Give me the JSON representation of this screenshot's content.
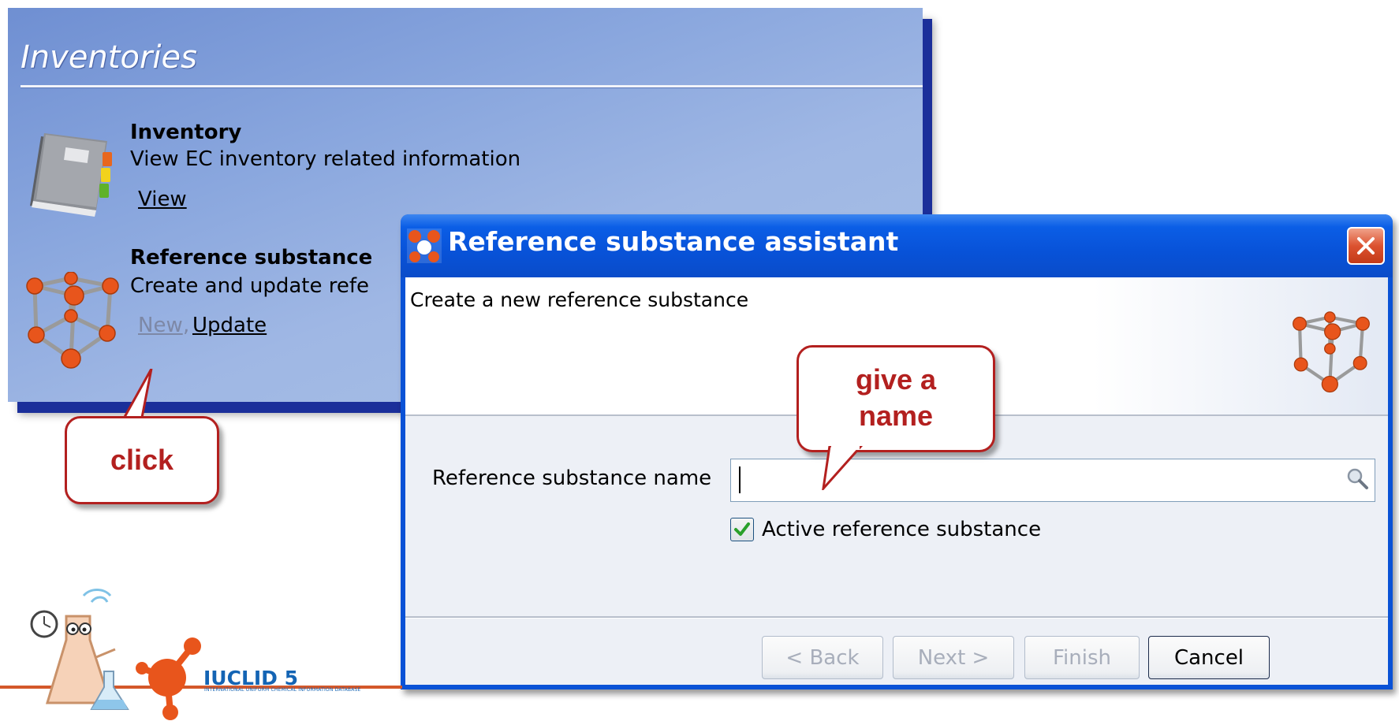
{
  "inventories_panel": {
    "title": "Inventories",
    "inventory": {
      "title": "Inventory",
      "description": "View EC inventory related information",
      "view_link": "View"
    },
    "reference_substance": {
      "title": "Reference substance",
      "description": "Create and update refe",
      "new_link": "New",
      "update_link": "Update"
    }
  },
  "callouts": {
    "click": "click",
    "give_a_name_line1": "give a",
    "give_a_name_line2": "name"
  },
  "dialog": {
    "title": "Reference substance assistant",
    "header_text": "Create a new reference substance",
    "field_label": "Reference substance name",
    "field_value": "",
    "checkbox_label": "Active reference substance",
    "checkbox_checked": true,
    "buttons": {
      "back": "< Back",
      "next": "Next >",
      "finish": "Finish",
      "cancel": "Cancel"
    }
  },
  "logo": {
    "text": "IUCLID 5",
    "subtitle": "INTERNATIONAL UNIFORM CHEMICAL INFORMATION DATABASE"
  },
  "colors": {
    "panel_blue": "#8aa7de",
    "titlebar_blue": "#0852d8",
    "callout_red": "#b3201f",
    "atom_orange": "#e8551c",
    "check_green": "#2aa02a"
  }
}
